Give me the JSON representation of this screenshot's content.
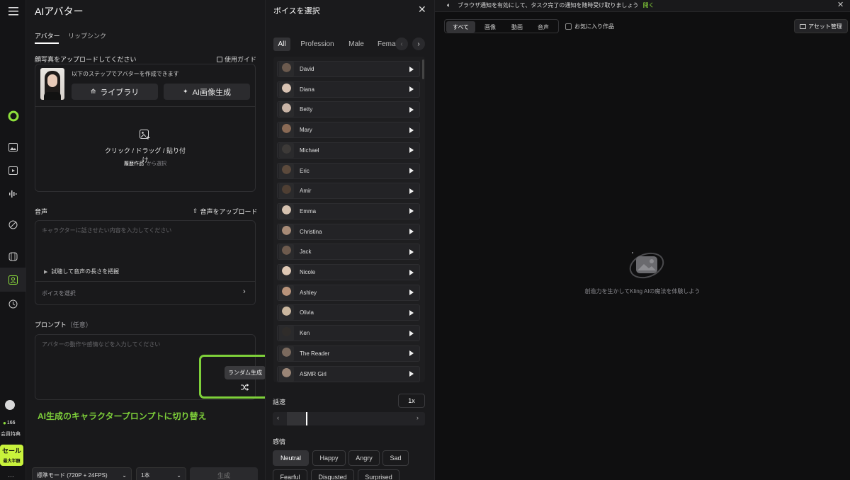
{
  "sidebar": {
    "credits": "166",
    "member_label": "会員特典",
    "sale_label": "セール",
    "sale_sub": "最大半額"
  },
  "panel": {
    "title": "AIアバター",
    "tabs": [
      "アバター",
      "リップシンク"
    ],
    "photo_section_label": "顔写真をアップロードしてください",
    "guide_link": "使用ガイド",
    "steps_text": "以下のステップでアバターを作成できます",
    "library_button": "ライブラリ",
    "ai_image_button": "AI画像生成",
    "upload_hint": "クリック / ドラッグ / 貼り付け",
    "history_link": "履歴作品",
    "history_suffix": "から選択",
    "audio_label": "音声",
    "upload_audio": "音声をアップロード",
    "speech_placeholder": "キャラクターに話させたい内容を入力してください",
    "preview_text": "試聴して音声の長さを把握",
    "voice_select": "ボイスを選択",
    "prompt_label": "プロンプト",
    "prompt_optional": "（任意）",
    "prompt_placeholder": "アバターの動作や感情などを入力してください",
    "tooltip": "ランダム生成",
    "annotation": "AI生成のキャラクタープロンプトに切り替え",
    "mode_select": "標準モード (720P + 24FPS)",
    "count_select": "1本",
    "generate_button": "生成"
  },
  "voice_panel": {
    "title": "ボイスを選択",
    "filters": [
      "All",
      "Profession",
      "Male",
      "Fema"
    ],
    "voices": [
      "David",
      "Diana",
      "Betty",
      "Mary",
      "Michael",
      "Eric",
      "Amir",
      "Emma",
      "Christina",
      "Jack",
      "Nicole",
      "Ashley",
      "Olivia",
      "Ken",
      "The Reader",
      "ASMR Girl"
    ],
    "speed_label": "話速",
    "speed_value": "1x",
    "emotion_label": "感情",
    "emotions": [
      "Neutral",
      "Happy",
      "Angry",
      "Sad",
      "Fearful",
      "Disgusted",
      "Surprised"
    ],
    "selected_emotion": "Neutral"
  },
  "assets": {
    "banner_text": "ブラウザ通知を有効にして、タスク完了の通知を随時受け取りましょう",
    "banner_link": "開く",
    "tabs": [
      "すべて",
      "画像",
      "動画",
      "音声"
    ],
    "favorites_label": "お気に入り作品",
    "asset_manage": "アセット管理",
    "empty_text": "創造力を生かしてKling AIの魔法を体験しよう"
  },
  "colors": {
    "accent_green": "#8ee03c",
    "annotation_green": "#7ed03a",
    "sale_bg": "#c8f23c"
  }
}
